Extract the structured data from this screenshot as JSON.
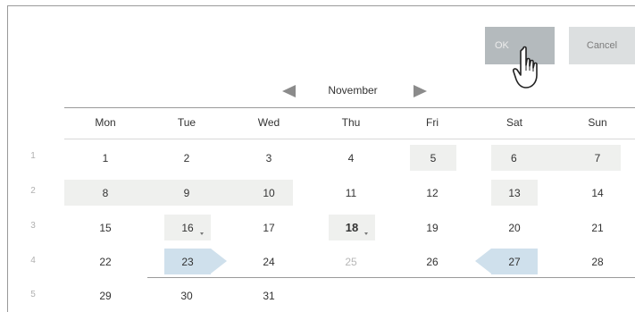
{
  "buttons": {
    "ok_label": "OK",
    "cancel_label": "Cancel"
  },
  "calendar": {
    "month": "November",
    "weekdays": [
      "Mon",
      "Tue",
      "Wed",
      "Thu",
      "Fri",
      "Sat",
      "Sun"
    ],
    "week_numbers": [
      "1",
      "2",
      "3",
      "4",
      "5"
    ],
    "weeks": [
      [
        "1",
        "2",
        "3",
        "4",
        "5",
        "6",
        "7"
      ],
      [
        "8",
        "9",
        "10",
        "11",
        "12",
        "13",
        "14"
      ],
      [
        "15",
        "16",
        "17",
        "18",
        "19",
        "20",
        "21"
      ],
      [
        "22",
        "23",
        "24",
        "25",
        "26",
        "27",
        "28"
      ],
      [
        "29",
        "30",
        "31",
        "",
        "",
        "",
        ""
      ]
    ],
    "colors": {
      "range_highlight": "#cfe0ec",
      "shaded_cell": "#eff0ee",
      "ok_button": "#b4babd",
      "cancel_button": "#dcdfe0"
    }
  },
  "icons": {
    "prev": "left-triangle-icon",
    "next": "right-triangle-icon",
    "cursor": "hand-pointer-icon"
  }
}
